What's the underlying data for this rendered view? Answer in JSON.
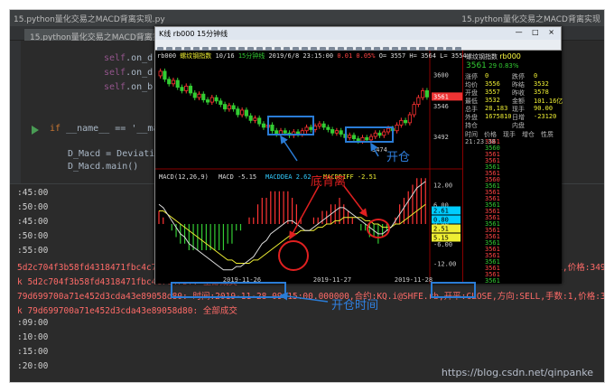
{
  "ide": {
    "title_left": "15.python量化交易之MACD背离实现.py",
    "title_right": "15.python量化交易之MACD背离实现",
    "editor_tab": "15.python量化交易之MACD背离实现.py"
  },
  "code_lines": [
    {
      "prefix": "self",
      "rest": ".on_d"
    },
    {
      "prefix": "self",
      "rest": ".on_d"
    },
    {
      "prefix": "self",
      "rest": ".on_b"
    },
    {
      "kw": "if",
      "rest": " __name__ == '__main__':"
    },
    {
      "rest": "D_Macd = Deviation"
    },
    {
      "rest": "D_Macd.main()"
    }
  ],
  "console_lines": [
    {
      "text": ":45:00",
      "red": false
    },
    {
      "text": ":50:00",
      "red": false
    },
    {
      "text": ":45:00",
      "red": false
    },
    {
      "text": ":50:00",
      "red": false
    },
    {
      "text": ":55:00",
      "red": false
    },
    {
      "text": "5d2c704f3b58fd4318471fbc4c7047bf: 时间:2019-11-28 09:15:00.000000,合约:KQ.i@SHFE.rb,开平:OPEN,方向:BUY,手数:1,价格:3493.185",
      "red": true
    },
    {
      "text": "k 5d2c704f3b58fd4318471fbc4c7047bf: 全部成交",
      "red": true
    },
    {
      "text": "79d699700a71e452d3cda43e89058d80: 时间:2019-11-28 09:15:00.000000,合约:KQ.i@SHFE.rb,开平:CLOSE,方向:SELL,手数:1,价格:3491.185",
      "red": true
    },
    {
      "text": "k 79d699700a71e452d3cda43e89058d80: 全部成交",
      "red": true
    },
    {
      "text": ":09:00",
      "red": false
    },
    {
      "text": ":10:00",
      "red": false
    },
    {
      "text": ":15:00",
      "red": false
    },
    {
      "text": ":20:00",
      "red": false
    }
  ],
  "watermark": "https://blog.csdn.net/qinpanke",
  "kwindow": {
    "title": "K线 rb000 15分钟线",
    "window_controls": "— □ ×",
    "info_line": {
      "symbol": "rb000",
      "name": "螺纹钢指数",
      "rank": "10/16",
      "period": "15分钟线",
      "datetime": "2019/6/8 23:15:00",
      "vals": "0.01  0.05%",
      "ohlc": "O= 3557 H= 3564 L= 3554"
    },
    "macd_label": "MACD(12,26,9)",
    "macd_vals": {
      "macd": "MACD -5.15",
      "dea": "MACDDEA 2.62",
      "diff": "MACDDIFF -2.51"
    },
    "price_ticks": [
      "3600",
      "3546",
      "3492"
    ],
    "macd_ticks": [
      "12.00",
      "6.00",
      "0.00",
      "-6.00",
      "-12.00"
    ],
    "date_ticks": [
      "2019-11-26",
      "2019-11-27",
      "2019-11-28"
    ],
    "low_label": "3474",
    "tags": [
      "2.61",
      "0.80",
      "2.51",
      "5.15"
    ],
    "price_tag": "3561"
  },
  "side_panel": {
    "name": "螺纹钢指数",
    "code": "rb000",
    "last": "3561",
    "chg": "29",
    "pct": "0.83%",
    "rows": [
      [
        "涨停",
        "0",
        "跌停",
        "0"
      ],
      [
        "均价",
        "3556",
        "昨结",
        "3532"
      ],
      [
        "开盘",
        "3557",
        "昨收",
        "3578"
      ],
      [
        "最低",
        "3532",
        "金额",
        "101.16亿"
      ],
      [
        "总手",
        "28,183",
        "现手",
        "90.00"
      ],
      [
        "外盘",
        "1675810",
        "日增",
        "-23120"
      ],
      [
        "持仓",
        "",
        "内盘",
        ""
      ]
    ],
    "trade_header": [
      "时间",
      "价格",
      "现手",
      "增仓",
      "性质"
    ],
    "first_time": "21:23:38",
    "trade_prices": [
      "3561",
      "3560",
      "3561",
      "3561",
      "3561",
      "3561",
      "3560",
      "3561",
      "3561",
      "3561",
      "3561",
      "3561",
      "3561",
      "3561",
      "3561",
      "3561",
      "3561",
      "3561",
      "3561",
      "3561",
      "3561",
      "3561",
      "3561"
    ]
  },
  "annotations": {
    "divergence": "底背离",
    "open_pos": "开仓",
    "open_time": "开仓时间"
  },
  "chart_data": {
    "type": "candlestick",
    "price_axis": [
      3440,
      3620
    ],
    "price_tick_values": [
      3600,
      3546,
      3492
    ],
    "candles": [
      [
        3598,
        3606
      ],
      [
        3606,
        3592
      ],
      [
        3592,
        3584
      ],
      [
        3584,
        3590
      ],
      [
        3590,
        3578
      ],
      [
        3578,
        3572
      ],
      [
        3572,
        3580
      ],
      [
        3580,
        3568
      ],
      [
        3568,
        3560
      ],
      [
        3560,
        3566
      ],
      [
        3566,
        3556
      ],
      [
        3556,
        3552
      ],
      [
        3552,
        3560
      ],
      [
        3560,
        3554
      ],
      [
        3554,
        3548
      ],
      [
        3548,
        3540
      ],
      [
        3540,
        3546
      ],
      [
        3546,
        3540
      ],
      [
        3540,
        3530
      ],
      [
        3530,
        3538
      ],
      [
        3538,
        3528
      ],
      [
        3528,
        3520
      ],
      [
        3520,
        3524
      ],
      [
        3524,
        3514
      ],
      [
        3514,
        3508
      ],
      [
        3508,
        3512
      ],
      [
        3512,
        3502
      ],
      [
        3502,
        3496
      ],
      [
        3496,
        3502
      ],
      [
        3502,
        3498
      ],
      [
        3498,
        3494
      ],
      [
        3494,
        3500
      ],
      [
        3500,
        3496
      ],
      [
        3496,
        3502
      ],
      [
        3502,
        3508
      ],
      [
        3508,
        3504
      ],
      [
        3504,
        3510
      ],
      [
        3510,
        3514
      ],
      [
        3514,
        3508
      ],
      [
        3508,
        3504
      ],
      [
        3504,
        3498
      ],
      [
        3498,
        3502
      ],
      [
        3502,
        3496
      ],
      [
        3496,
        3490
      ],
      [
        3490,
        3494
      ],
      [
        3494,
        3488
      ],
      [
        3488,
        3484
      ],
      [
        3484,
        3490
      ],
      [
        3490,
        3486
      ],
      [
        3486,
        3492
      ],
      [
        3492,
        3498
      ],
      [
        3498,
        3494
      ],
      [
        3494,
        3500
      ],
      [
        3500,
        3506
      ],
      [
        3506,
        3502
      ],
      [
        3502,
        3512
      ],
      [
        3512,
        3520
      ],
      [
        3520,
        3516
      ],
      [
        3516,
        3530
      ],
      [
        3530,
        3548
      ],
      [
        3548,
        3560
      ],
      [
        3560,
        3572
      ],
      [
        3572,
        3561
      ]
    ],
    "macd_axis": [
      -16,
      16
    ],
    "diff": [
      6,
      5,
      3,
      1,
      -1,
      -3,
      -4,
      -6,
      -7,
      -8,
      -9,
      -10,
      -11,
      -12,
      -13,
      -14,
      -14,
      -14,
      -13,
      -13,
      -12,
      -11,
      -10,
      -8,
      -6,
      -5,
      -3,
      -2,
      -1,
      0,
      1,
      1,
      0,
      -1,
      -2,
      -2,
      -1,
      0,
      1,
      2,
      3,
      4,
      5,
      5,
      4,
      3,
      2,
      1,
      0,
      -1,
      -2,
      -3,
      -3,
      -2,
      -1,
      1,
      3,
      5,
      7,
      9,
      11,
      12,
      13
    ],
    "dea": [
      4,
      4,
      3,
      2,
      1,
      0,
      -1,
      -2,
      -3,
      -4,
      -5,
      -6,
      -7,
      -8,
      -9,
      -10,
      -11,
      -11,
      -12,
      -12,
      -12,
      -12,
      -11,
      -11,
      -10,
      -9,
      -8,
      -7,
      -6,
      -5,
      -4,
      -3,
      -3,
      -2,
      -2,
      -2,
      -2,
      -1,
      -1,
      0,
      0,
      1,
      1,
      2,
      2,
      2,
      2,
      2,
      1,
      1,
      0,
      0,
      -1,
      -1,
      -1,
      0,
      0,
      1,
      2,
      3,
      4,
      5,
      6
    ],
    "hist": [
      4,
      2,
      0,
      -2,
      -4,
      -6,
      -6,
      -8,
      -8,
      -8,
      -8,
      -8,
      -8,
      -8,
      -8,
      -8,
      -6,
      -6,
      -2,
      -2,
      0,
      2,
      2,
      6,
      8,
      8,
      10,
      10,
      10,
      10,
      10,
      8,
      6,
      2,
      0,
      0,
      2,
      2,
      4,
      4,
      6,
      6,
      8,
      6,
      4,
      2,
      0,
      -2,
      -2,
      -4,
      -4,
      -6,
      -4,
      -2,
      0,
      2,
      6,
      8,
      10,
      12,
      14,
      14,
      14
    ],
    "date_ticks": [
      "2019-11-26",
      "2019-11-27",
      "2019-11-28"
    ]
  }
}
